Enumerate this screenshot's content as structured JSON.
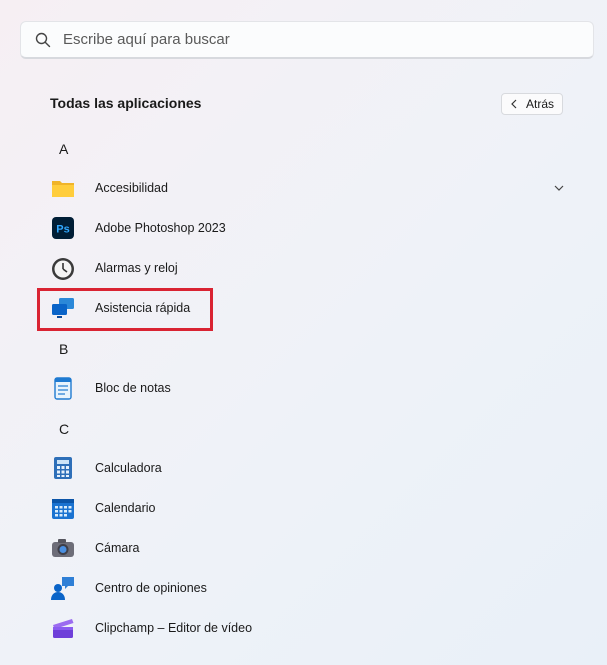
{
  "search": {
    "placeholder": "Escribe aquí para buscar"
  },
  "header": {
    "title": "Todas las aplicaciones",
    "back_label": "Atrás"
  },
  "groups": {
    "a": "A",
    "b": "B",
    "c": "C"
  },
  "apps": {
    "accesibilidad": "Accesibilidad",
    "photoshop": "Adobe Photoshop 2023",
    "photoshop_icon_text": "Ps",
    "alarmas": "Alarmas y reloj",
    "asistencia": "Asistencia rápida",
    "bloc": "Bloc de notas",
    "calculadora": "Calculadora",
    "calendario": "Calendario",
    "camara": "Cámara",
    "opiniones": "Centro de opiniones",
    "clipchamp": "Clipchamp – Editor de vídeo"
  },
  "colors": {
    "highlight": "#d92332",
    "accent": "#0a64c8"
  }
}
